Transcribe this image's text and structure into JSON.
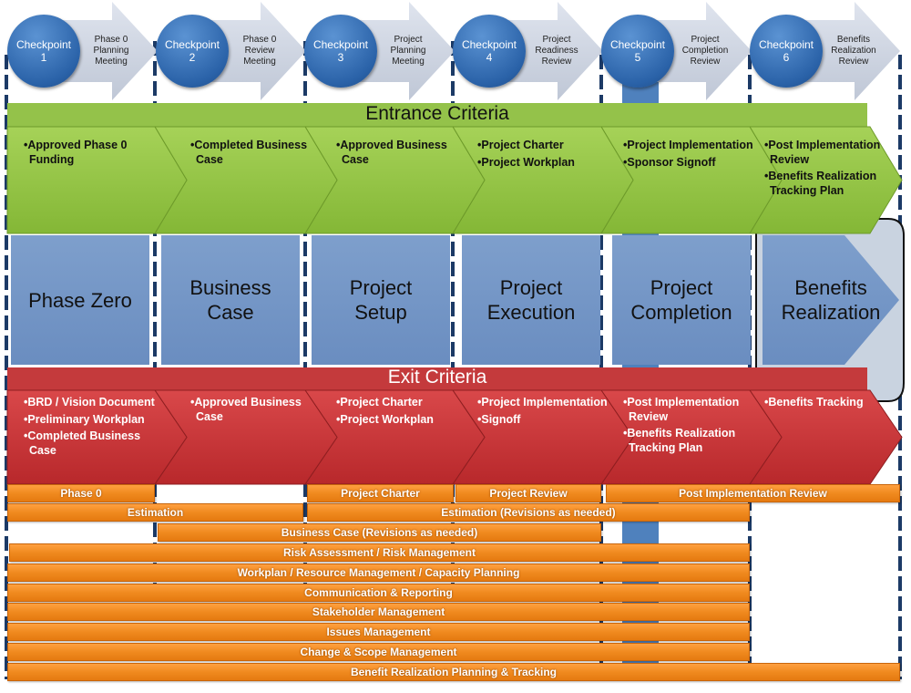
{
  "checkpoints": [
    {
      "label": "Checkpoint",
      "num": "1",
      "meeting": "Phase 0 Planning Meeting"
    },
    {
      "label": "Checkpoint",
      "num": "2",
      "meeting": "Phase 0 Review Meeting"
    },
    {
      "label": "Checkpoint",
      "num": "3",
      "meeting": "Project Planning Meeting"
    },
    {
      "label": "Checkpoint",
      "num": "4",
      "meeting": "Project Readiness Review"
    },
    {
      "label": "Checkpoint",
      "num": "5",
      "meeting": "Project Completion Review"
    },
    {
      "label": "Checkpoint",
      "num": "6",
      "meeting": "Benefits Realization Review"
    }
  ],
  "entrance": {
    "title": "Entrance Criteria",
    "items": [
      [
        "•Approved Phase 0 Funding"
      ],
      [
        "•Completed Business Case"
      ],
      [
        "•Approved Business Case"
      ],
      [
        "•Project Charter",
        "•Project Workplan"
      ],
      [
        "•Project Implementation",
        "•Sponsor Signoff"
      ],
      [
        "•Post Implementation Review",
        "•Benefits Realization Tracking Plan"
      ]
    ]
  },
  "phases": [
    "Phase Zero",
    "Business Case",
    "Project Setup",
    "Project Execution",
    "Project Completion",
    "Benefits Realization"
  ],
  "exit": {
    "title": "Exit Criteria",
    "items": [
      [
        "•BRD / Vision Document",
        "•Preliminary Workplan",
        "•Completed Business Case"
      ],
      [
        "•Approved Business Case"
      ],
      [
        "•Project Charter",
        "•Project Workplan"
      ],
      [
        "•Project Implementation",
        "•Signoff"
      ],
      [
        "•Post Implementation Review",
        "•Benefits Realization Tracking Plan"
      ],
      [
        "•Benefits Tracking"
      ]
    ]
  },
  "activities": [
    "Phase 0",
    "Project Charter",
    "Project Review",
    "Post Implementation Review",
    "Estimation",
    "Estimation (Revisions as needed)",
    "Business Case (Revisions as needed)",
    "Risk Assessment / Risk Management",
    "Workplan / Resource Management / Capacity Planning",
    "Communication & Reporting",
    "Stakeholder Management",
    "Issues Management",
    "Change & Scope Management",
    "Benefit Realization Planning & Tracking"
  ],
  "colors": {
    "checkpoint": "#2a62a8",
    "entrance": "#8fc23e",
    "phase": "#7294c4",
    "exit": "#c8383a",
    "activity": "#f08a1f",
    "divider": "#1c3a66"
  }
}
